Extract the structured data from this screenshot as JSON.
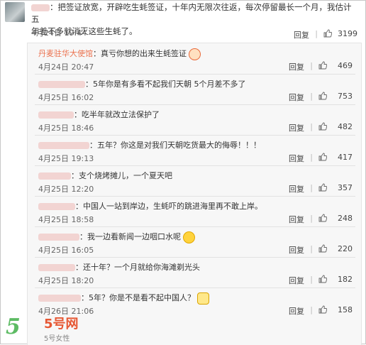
{
  "top_comment": {
    "text_line1": "：把签证放宽，开辟吃生蚝签证，十年内无限次往返，每次停留最长一个月，我估计五",
    "text_line2": "年差不多就消灭这些生蚝了。",
    "date": "4月24日 19:44",
    "reply_label": "回复",
    "likes": "3199"
  },
  "replies": [
    {
      "name": "丹麦驻华大使馆",
      "text": "：真亏你想的出来生蚝签证",
      "emoji": "grin-icon",
      "date": "4月24日 20:47",
      "likes": "469"
    },
    {
      "text": "：5年你是有多看不起我们天朝 5个月差不多了",
      "date": "4月25日 16:02",
      "likes": "753"
    },
    {
      "text": "：吃半年就改立法保护了",
      "date": "4月25日 18:46",
      "likes": "482"
    },
    {
      "text": "：五年？你这是对我们天朝吃货最大的侮辱！！！",
      "date": "4月25日 19:13",
      "likes": "417"
    },
    {
      "text": "：支个烧烤摊儿，一个夏天吧",
      "date": "4月25日 12:20",
      "likes": "357"
    },
    {
      "text": "：中国人一站到岸边，生蚝吓的跳进海里再不敢上岸。",
      "date": "4月25日 18:58",
      "likes": "248"
    },
    {
      "text": "：我一边看新闻一边咽口水呢",
      "emoji": "drool-icon",
      "date": "4月25日 16:05",
      "likes": "220"
    },
    {
      "text": "：还十年？一个月就给你海滩剃光头",
      "date": "4月25日 18:20",
      "likes": "182"
    },
    {
      "text": "：5年？你是不是看不起中国人？",
      "emoji": "cat-face-icon",
      "date": "4月26日 21:06",
      "likes": "158"
    }
  ],
  "ui": {
    "reply_label": "回复",
    "separator": "|"
  },
  "watermark": {
    "logo": "5",
    "name": "5号网",
    "sub": "5号女性"
  }
}
